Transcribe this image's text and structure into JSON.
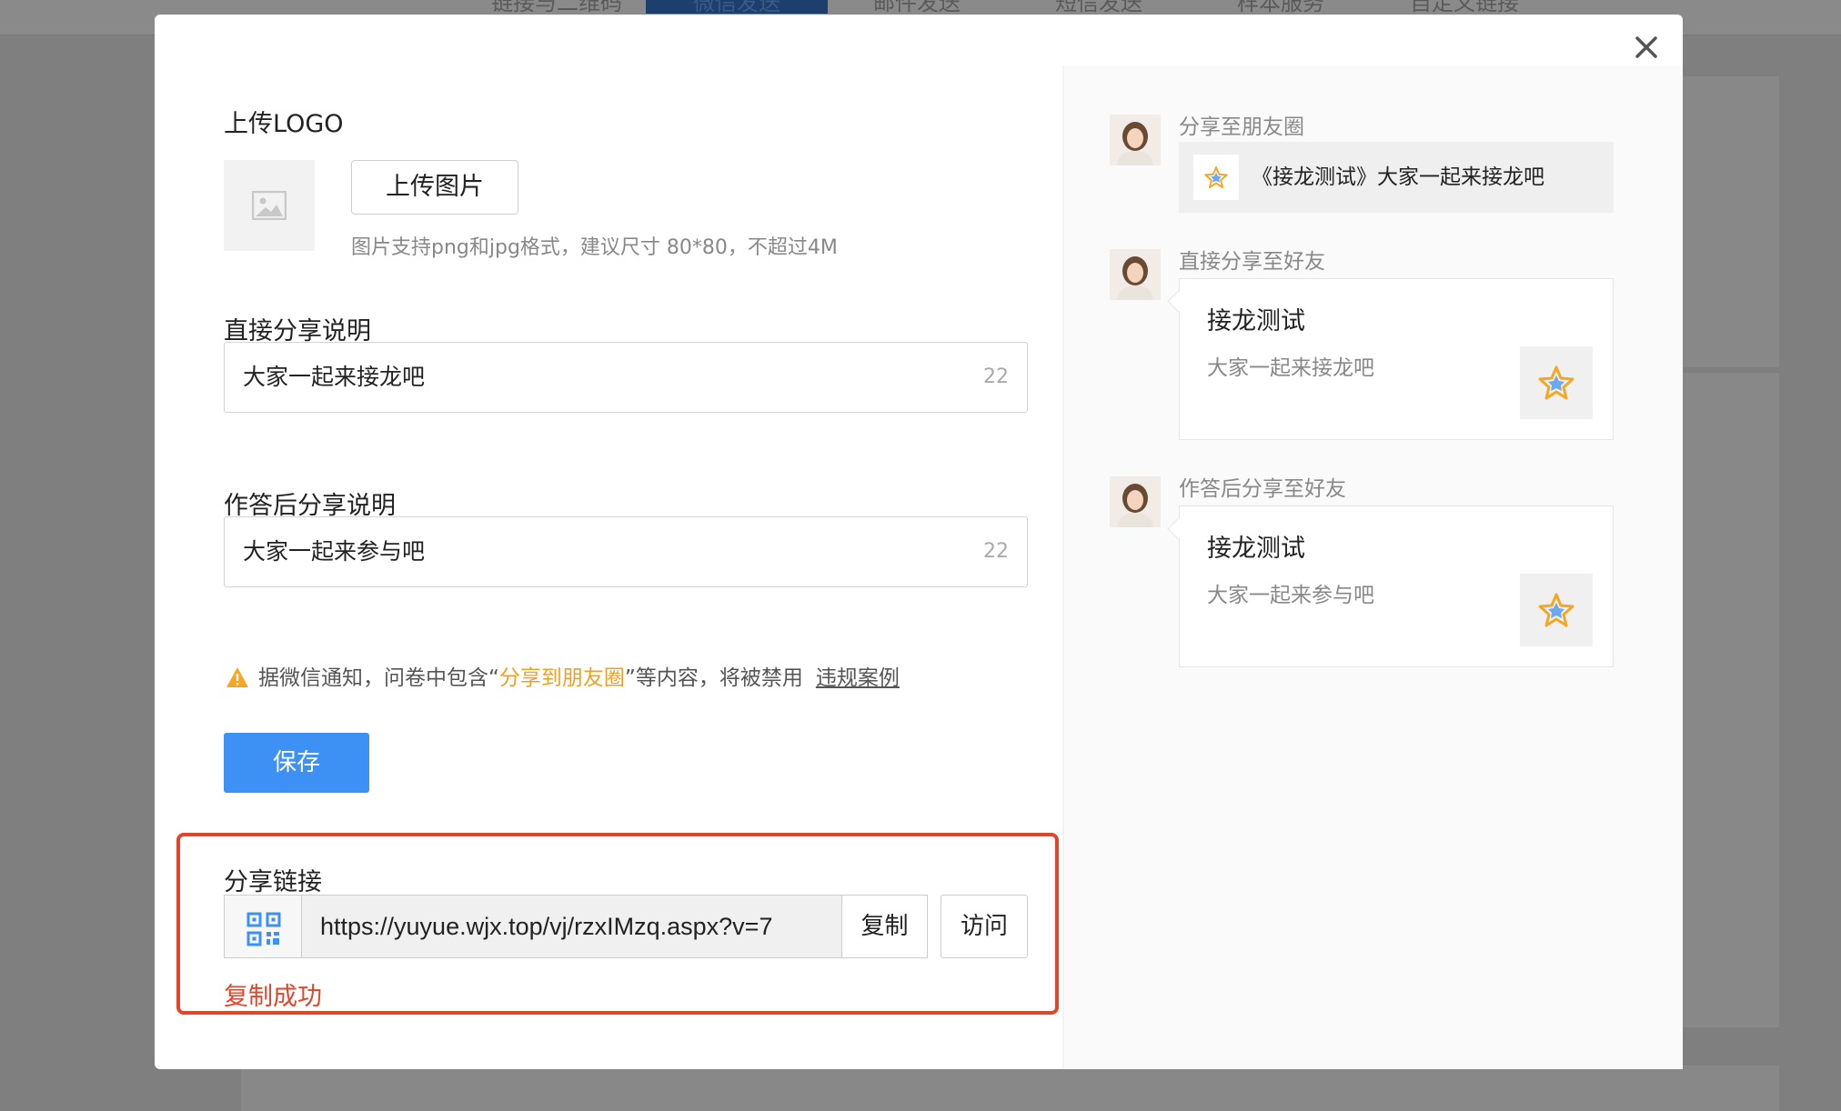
{
  "background": {
    "tabs": [
      "链接与二维码",
      "微信发送",
      "邮件发送",
      "短信发送",
      "样本服务",
      "自定义链接"
    ],
    "active_tab": "微信发送"
  },
  "modal": {
    "logo_section": {
      "title": "上传LOGO",
      "upload_button": "上传图片",
      "hint": "图片支持png和jpg格式，建议尺寸 80*80，不超过4M"
    },
    "direct_share": {
      "title": "直接分享说明",
      "value": "大家一起来接龙吧",
      "count": "22"
    },
    "after_answer_share": {
      "title": "作答后分享说明",
      "value": "大家一起来参与吧",
      "count": "22"
    },
    "warning": {
      "prefix": "据微信通知，问卷中包含“",
      "highlight": "分享到朋友圈",
      "suffix": "”等内容，将被禁用",
      "link": "违规案例",
      "icon": "warning-triangle-icon",
      "highlight_color": "#f0a020"
    },
    "save_button": "保存",
    "share_link": {
      "title": "分享链接",
      "url": "https://yuyue.wjx.top/vj/rzxIMzq.aspx?v=7",
      "copy_button": "复制",
      "visit_button": "访问",
      "status": "复制成功",
      "qr_icon": "qr-code-icon"
    },
    "preview": {
      "moments": {
        "label": "分享至朋友圈",
        "text": "《接龙测试》大家一起来接龙吧"
      },
      "direct": {
        "label": "直接分享至好友",
        "title": "接龙测试",
        "desc": "大家一起来接龙吧"
      },
      "after_answer": {
        "label": "作答后分享至好友",
        "title": "接龙测试",
        "desc": "大家一起来参与吧"
      }
    },
    "colors": {
      "primary": "#3d91f5",
      "danger": "#e2452a",
      "warning": "#f0a020"
    }
  }
}
